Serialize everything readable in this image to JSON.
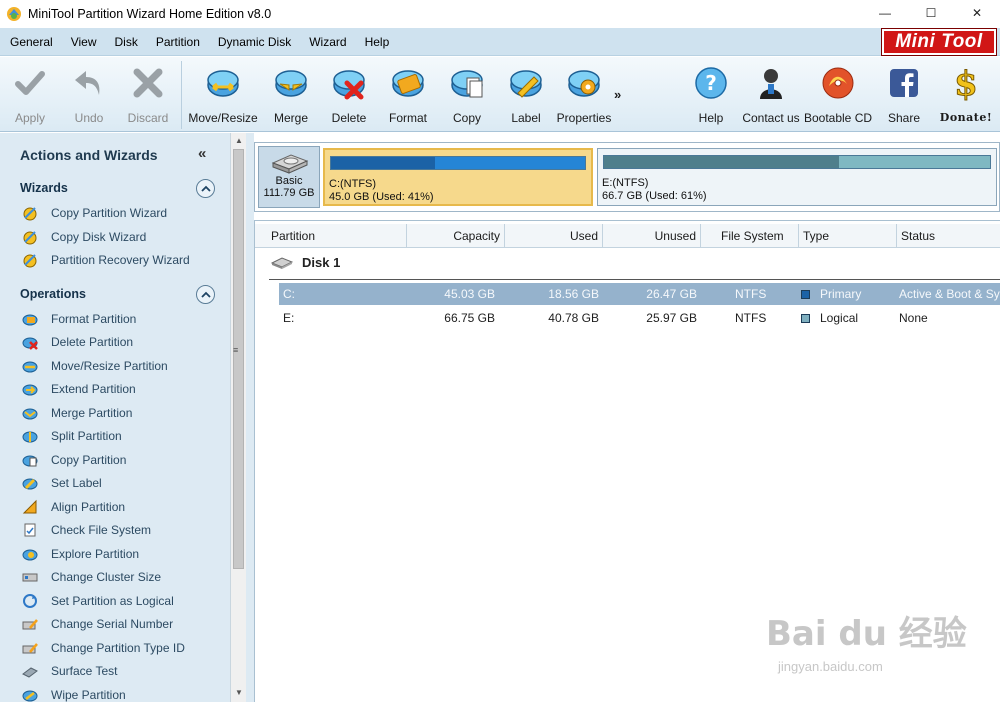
{
  "window": {
    "title": "MiniTool Partition Wizard Home Edition v8.0",
    "minimize": "—",
    "maximize": "☐",
    "close": "✕"
  },
  "menu": {
    "items": [
      "General",
      "View",
      "Disk",
      "Partition",
      "Dynamic Disk",
      "Wizard",
      "Help"
    ],
    "brand_mini": "Mini",
    "brand_tool": "Tool"
  },
  "toolbar": {
    "apply": "Apply",
    "undo": "Undo",
    "discard": "Discard",
    "move_resize": "Move/Resize",
    "merge": "Merge",
    "delete": "Delete",
    "format": "Format",
    "copy": "Copy",
    "label": "Label",
    "properties": "Properties",
    "more": "»",
    "help": "Help",
    "contact": "Contact us",
    "bootable": "Bootable CD",
    "share": "Share",
    "donate": "Donate!"
  },
  "sidebar": {
    "header": "Actions and Wizards",
    "collapse": "«",
    "wizards_title": "Wizards",
    "wizards": [
      "Copy Partition Wizard",
      "Copy Disk Wizard",
      "Partition Recovery Wizard"
    ],
    "operations_title": "Operations",
    "operations": [
      "Format Partition",
      "Delete Partition",
      "Move/Resize Partition",
      "Extend Partition",
      "Merge Partition",
      "Split Partition",
      "Copy Partition",
      "Set Label",
      "Align Partition",
      "Check File System",
      "Explore Partition",
      "Change Cluster Size",
      "Set Partition as Logical",
      "Change Serial Number",
      "Change Partition Type ID",
      "Surface Test",
      "Wipe Partition"
    ],
    "toggle": "^"
  },
  "diskmap": {
    "disk_type": "Basic",
    "disk_size": "111.79 GB",
    "partitions": [
      {
        "name": "C:(NTFS)",
        "detail": "45.0 GB (Used: 41%)",
        "used_fraction": 0.41,
        "color": "#1b62a6"
      },
      {
        "name": "E:(NTFS)",
        "detail": "66.7 GB (Used: 61%)",
        "used_fraction": 0.61,
        "color": "#4f7f8c"
      }
    ]
  },
  "table": {
    "headers": [
      "Partition",
      "Capacity",
      "Used",
      "Unused",
      "File System",
      "Type",
      "Status"
    ],
    "disk_label": "Disk 1",
    "rows": [
      {
        "partition": "C:",
        "capacity": "45.03 GB",
        "used": "18.56 GB",
        "unused": "26.47 GB",
        "fs": "NTFS",
        "type": "Primary",
        "status": "Active & Boot & Syst",
        "type_color": "#1b62a6"
      },
      {
        "partition": "E:",
        "capacity": "66.75 GB",
        "used": "40.78 GB",
        "unused": "25.97 GB",
        "fs": "NTFS",
        "type": "Logical",
        "status": "None",
        "type_color": "#7fb0c0"
      }
    ]
  },
  "watermark": {
    "brand": "Bai du 经验",
    "url": "jingyan.baidu.com"
  }
}
